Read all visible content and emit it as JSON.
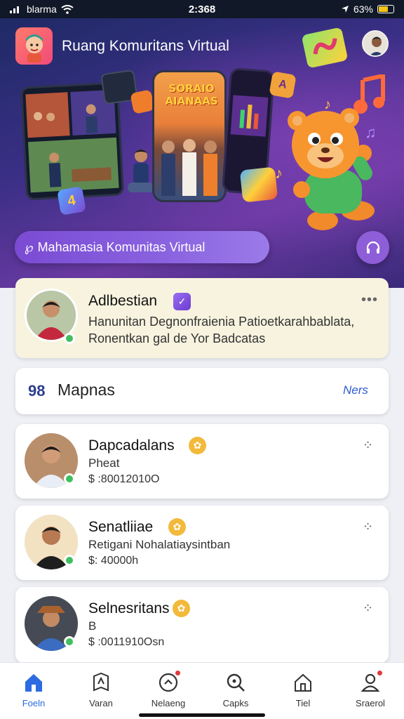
{
  "status_bar": {
    "carrier": "blarma",
    "time": "2:368",
    "battery": "63%",
    "battery_level": 0.63
  },
  "app": {
    "title": "Ruang Komuritans Virtual"
  },
  "hero": {
    "poster_text": "SORAIO AIANAAS",
    "cta_label": "Mahamasia Komunitas Virtual",
    "cta_icon": "community-icon",
    "fab_icon": "headset-icon"
  },
  "featured": {
    "name": "Adlbestian",
    "line1": "Hanunitan Degnonfraienia Patioetkarahbablata,",
    "line2": "Ronentkan gal de Yor Badcatas"
  },
  "section": {
    "icon_text": "98",
    "title": "Mapnas",
    "link": "Ners"
  },
  "members": [
    {
      "name": "Dapcadalans",
      "subtitle": "Pheat",
      "price": "$ :80012010O"
    },
    {
      "name": "Senatliiae",
      "subtitle": "Retigani Nohalatiaysintban",
      "price": "$: 40000h"
    },
    {
      "name": "Selnesritans",
      "subtitle": "B",
      "price": "$ :0011910Osn"
    }
  ],
  "nav": [
    {
      "label": "Foeln",
      "icon": "home-icon",
      "active": true
    },
    {
      "label": "Varan",
      "icon": "map-icon"
    },
    {
      "label": "Nelaeng",
      "icon": "activity-icon",
      "dot": true
    },
    {
      "label": "Capks",
      "icon": "search-icon"
    },
    {
      "label": "Tiel",
      "icon": "house-icon"
    },
    {
      "label": "Sraerol",
      "icon": "profile-icon",
      "dot": true
    }
  ],
  "colors": {
    "accent": "#2c6be0",
    "hero_cta": "#7b4bd3",
    "featured_bg": "#f7f3df",
    "online": "#3fbf5f"
  }
}
